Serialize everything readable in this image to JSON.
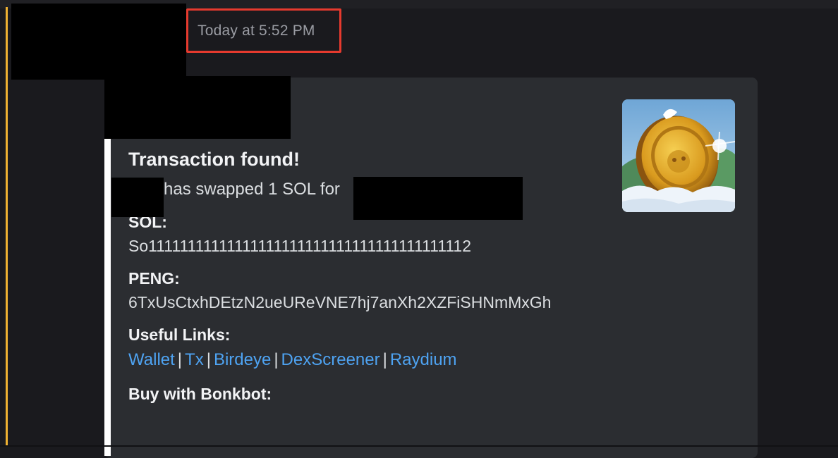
{
  "message": {
    "timestamp": "Today at 5:52 PM"
  },
  "embed": {
    "title": "Transaction found!",
    "swap_text": "has swapped 1 SOL for",
    "fields": [
      {
        "name": "SOL:",
        "value": "So11111111111111111111111111111111111111112"
      },
      {
        "name": "PENG:",
        "value": "6TxUsCtxhDEtzN2ueUReVNE7hj7anXh2XZFiSHNmMxGh"
      }
    ],
    "links_label": "Useful Links:",
    "links": [
      "Wallet",
      "Tx",
      "Birdeye",
      "DexScreener",
      "Raydium"
    ],
    "link_separator": "|",
    "buy_label": "Buy with Bonkbot:"
  },
  "colors": {
    "accent_link": "#4ea3f2",
    "highlight_border": "#e63a2e",
    "mention_bar": "#f0b232",
    "embed_bg": "#2b2d31"
  },
  "icons": {
    "thumbnail": "gold-coin-thumbnail-icon"
  }
}
